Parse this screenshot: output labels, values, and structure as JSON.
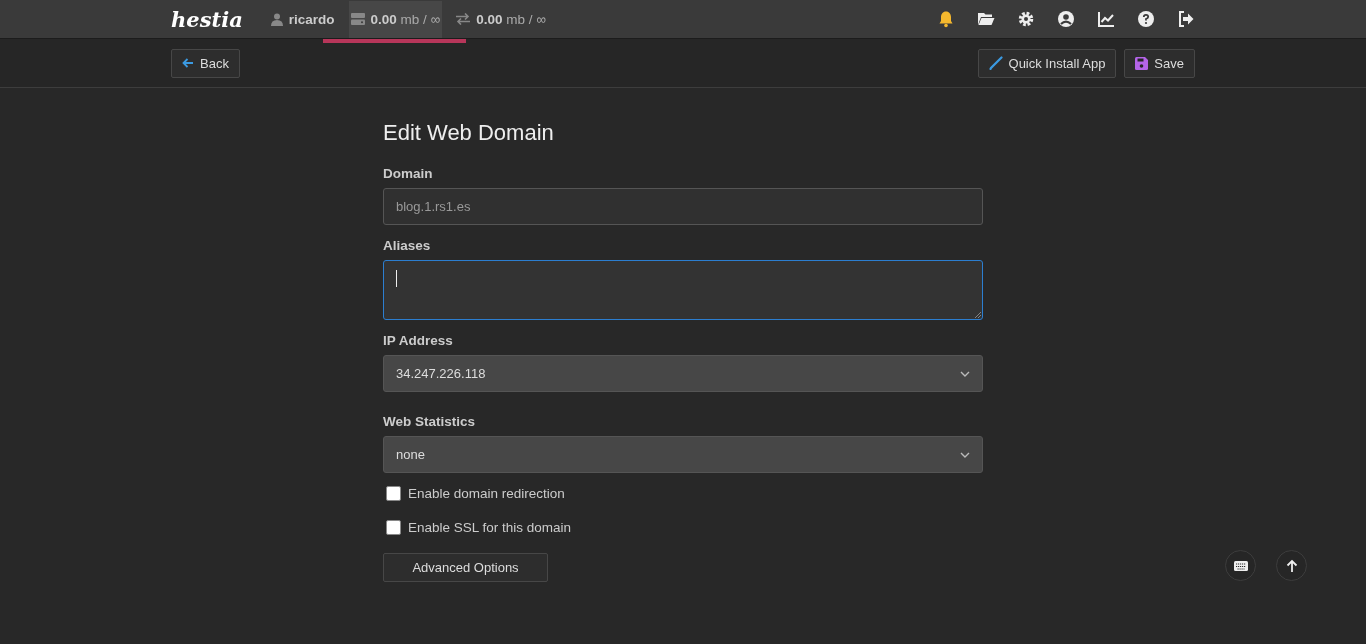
{
  "top_bar": {
    "logo": "hestia",
    "stats": [
      {
        "kind": "user",
        "text": "ricardo",
        "selected": false
      },
      {
        "kind": "disk",
        "text": "**0.00** mb / ∞",
        "selected": true
      },
      {
        "kind": "bandwidth",
        "text": "**0.00** mb / ∞",
        "selected": false
      }
    ],
    "icons": [
      {
        "kind": "bell",
        "highlighted": true
      },
      {
        "kind": "folder",
        "highlighted": false
      },
      {
        "kind": "gear",
        "highlighted": false
      },
      {
        "kind": "user",
        "highlighted": false
      },
      {
        "kind": "chart",
        "highlighted": false
      },
      {
        "kind": "help",
        "highlighted": false
      },
      {
        "kind": "logout",
        "highlighted": false
      }
    ]
  },
  "toolbar": {
    "back": "Back",
    "actions": [
      {
        "kind": "install",
        "label": "Quick Install App"
      },
      {
        "kind": "save",
        "label": "Save"
      }
    ]
  },
  "form": {
    "title": "Edit Web Domain",
    "fields": [
      {
        "kind": "input",
        "label": "Domain",
        "value": "blog.1.rs1.es",
        "disabled": true,
        "focused": false
      },
      {
        "kind": "textarea",
        "label": "Aliases",
        "disabled": false,
        "focused": true
      },
      {
        "kind": "select",
        "label": "IP Address",
        "value": "34.247.226.118",
        "disabled": false,
        "focused": false
      },
      {
        "kind": "select",
        "label": "Web Statistics",
        "value": "none",
        "disabled": false,
        "focused": false
      }
    ],
    "checkboxes": [
      {
        "label": "Enable domain redirection",
        "checked": false
      },
      {
        "label": "Enable SSL for this domain",
        "checked": false
      }
    ],
    "advanced": "Advanced Options"
  },
  "floating": [
    {
      "kind": "keyboard"
    },
    {
      "kind": "top"
    }
  ]
}
